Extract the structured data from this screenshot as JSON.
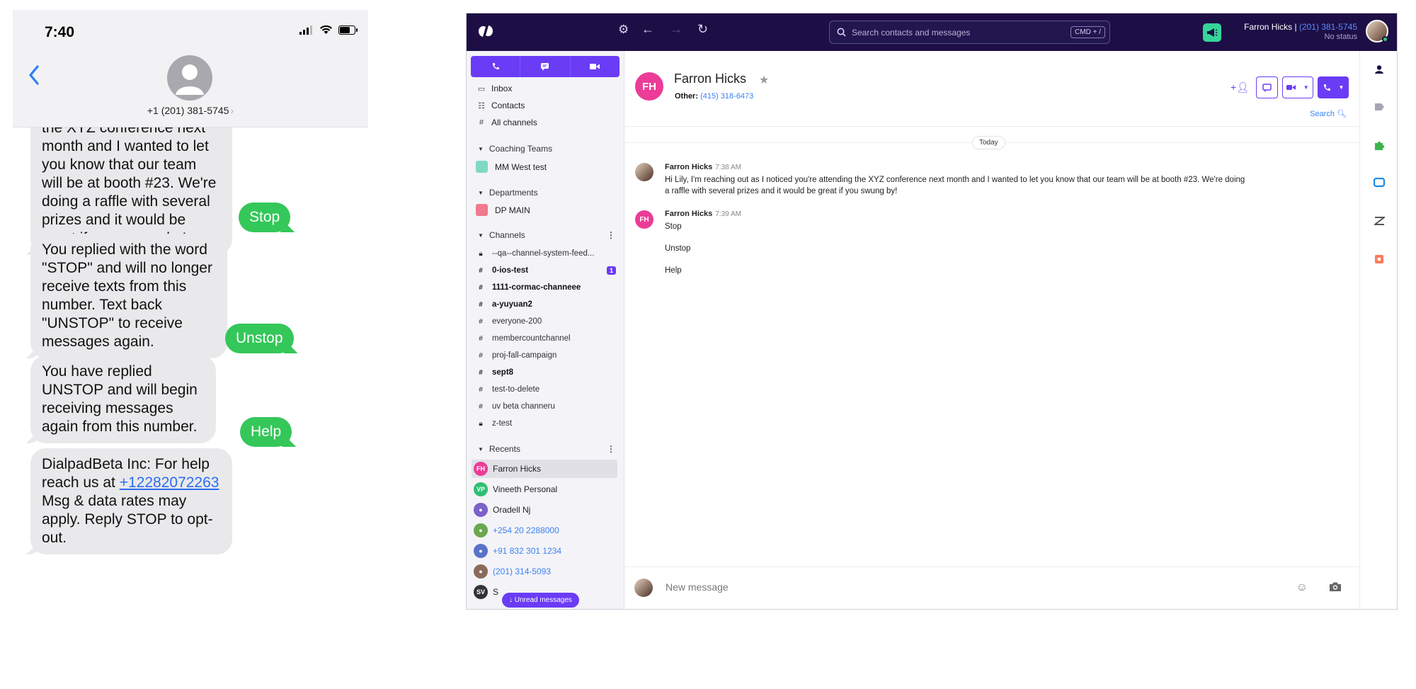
{
  "phone": {
    "time": "7:40",
    "contact_number": "+1 (201) 381-5745",
    "messages": [
      {
        "dir": "in",
        "text": "noticed you're attending the XYZ conference next month and I wanted to let you know that our team will be at booth #23. We're doing a raffle with several prizes and it would be great if you swung by!"
      },
      {
        "dir": "out",
        "text": "Stop"
      },
      {
        "dir": "in",
        "text": "You replied with the word \"STOP\" and will no longer receive texts from this number. Text back \"UNSTOP\" to receive messages again."
      },
      {
        "dir": "out",
        "text": "Unstop"
      },
      {
        "dir": "in",
        "text": "You have replied UNSTOP and will begin receiving messages again from this number."
      },
      {
        "dir": "out",
        "text": "Help"
      },
      {
        "dir": "in",
        "text_before": "DialpadBeta Inc: For help reach us at ",
        "link": "+12282072263",
        "text_after": " Msg & data rates may apply. Reply STOP to opt-out."
      }
    ]
  },
  "app": {
    "search_placeholder": "Search contacts and messages",
    "search_shortcut": "CMD + /",
    "user": {
      "name": "Farron Hicks |",
      "phone": "(201) 381-5745",
      "status": "No status"
    },
    "sidebar": {
      "nav": [
        {
          "label": "Inbox",
          "icon": "inbox-icon"
        },
        {
          "label": "Contacts",
          "icon": "contacts-icon"
        },
        {
          "label": "All channels",
          "icon": "hash-icon"
        }
      ],
      "coaching_title": "Coaching Teams",
      "coaching": [
        {
          "label": "MM West test",
          "color": "#7fd8c2"
        }
      ],
      "departments_title": "Departments",
      "departments": [
        {
          "label": "DP MAIN",
          "color": "#f07a8f"
        }
      ],
      "channels_title": "Channels",
      "channels": [
        {
          "label": "--qa--channel-system-feed...",
          "icon": "lock",
          "bold": false,
          "badge": ""
        },
        {
          "label": "0-ios-test",
          "icon": "hash",
          "bold": true,
          "badge": "1"
        },
        {
          "label": "1111-cormac-channeee",
          "icon": "hash",
          "bold": true,
          "badge": ""
        },
        {
          "label": "a-yuyuan2",
          "icon": "hash",
          "bold": true,
          "badge": ""
        },
        {
          "label": "everyone-200",
          "icon": "hash",
          "bold": false,
          "badge": ""
        },
        {
          "label": "membercountchannel",
          "icon": "hash",
          "bold": false,
          "badge": ""
        },
        {
          "label": "proj-fall-campaign",
          "icon": "hash",
          "bold": false,
          "badge": ""
        },
        {
          "label": "sept8",
          "icon": "hash",
          "bold": true,
          "badge": ""
        },
        {
          "label": "test-to-delete",
          "icon": "hash",
          "bold": false,
          "badge": ""
        },
        {
          "label": "uv beta channeru",
          "icon": "hash",
          "bold": false,
          "badge": ""
        },
        {
          "label": "z-test",
          "icon": "lock",
          "bold": false,
          "badge": ""
        }
      ],
      "recents_title": "Recents",
      "recents": [
        {
          "label": "Farron Hicks",
          "initials": "FH",
          "color": "#ec3c97",
          "number": false
        },
        {
          "label": "Vineeth Personal",
          "initials": "VP",
          "color": "#2fbf71",
          "number": false
        },
        {
          "label": "Oradell Nj",
          "initials": "",
          "color": "#7b61c9",
          "number": false
        },
        {
          "label": "+254 20 2288000",
          "initials": "",
          "color": "#6aa84f",
          "number": true
        },
        {
          "label": "+91 832 301 1234",
          "initials": "",
          "color": "#5a72c9",
          "number": true
        },
        {
          "label": "(201) 314-5093",
          "initials": "",
          "color": "#8a6a5a",
          "number": true
        },
        {
          "label": "S",
          "initials": "SV",
          "color": "#333333",
          "number": false
        }
      ],
      "unread_label": "↓ Unread messages"
    },
    "conversation": {
      "initials": "FH",
      "name": "Farron Hicks",
      "other_label": "Other:",
      "other_phone": "(415) 318-6473",
      "search_label": "Search",
      "day_label": "Today",
      "messages": [
        {
          "sender": "Farron Hicks",
          "time": "7:38 AM",
          "lines": [
            "Hi Lily, I'm reaching out as I noticed you're attending the XYZ conference next month and I wanted to let you know that our team will be at booth #23. We're doing",
            "a raffle with several prizes and it would be great if you swung by!"
          ]
        },
        {
          "sender": "Farron Hicks",
          "time": "7:39 AM",
          "lines": [
            "Stop",
            "Unstop",
            "Help"
          ]
        }
      ],
      "composer_placeholder": "New message"
    },
    "colors": {
      "brand_dark": "#1d0f45",
      "accent": "#6a3cf5",
      "link": "#3b82f6",
      "contact_pink": "#ec3c97"
    }
  }
}
